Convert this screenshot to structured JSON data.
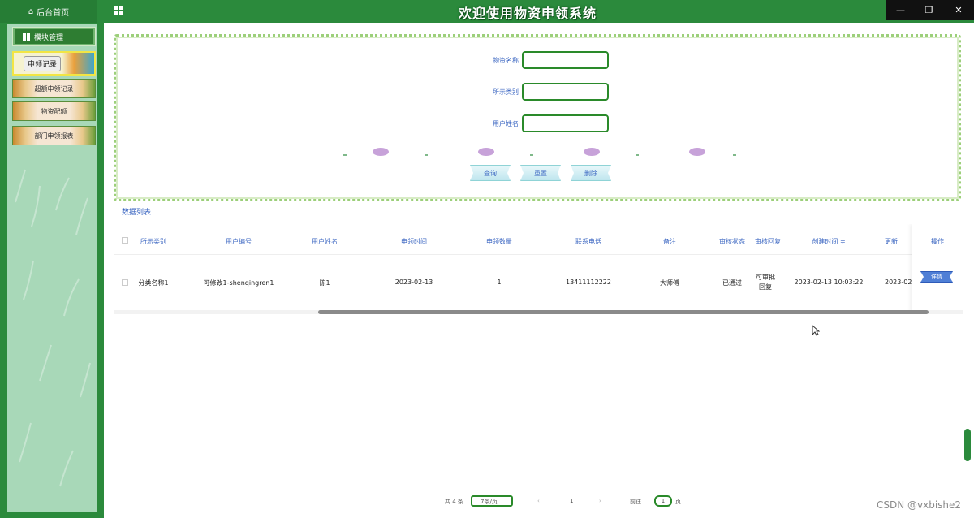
{
  "header": {
    "home_label": "后台首页",
    "title": "欢迎使用物资申领系统"
  },
  "window_controls": {
    "minimize": "—",
    "restore": "❐",
    "close": "✕"
  },
  "sidebar": {
    "section_label": "模块管理",
    "items": [
      {
        "label": "申领记录",
        "active": true
      },
      {
        "label": "超额申领记录"
      },
      {
        "label": "物资配额"
      },
      {
        "label": "部门申领报表"
      }
    ]
  },
  "search": {
    "fields": [
      {
        "label": "物资名称",
        "value": ""
      },
      {
        "label": "所示类别",
        "value": ""
      },
      {
        "label": "用户姓名",
        "value": ""
      }
    ],
    "buttons": {
      "query": "查询",
      "reset": "重置",
      "delete": "删除"
    }
  },
  "list_title": "数据列表",
  "table": {
    "columns": [
      "所示类别",
      "用户编号",
      "用户姓名",
      "申领时间",
      "申领数量",
      "联系电话",
      "备注",
      "审核状态",
      "审核回复",
      "创建时间 ≑",
      "更新",
      "操作"
    ],
    "rows": [
      {
        "category": "分类名称1",
        "user_no": "可修改1-shenqingren1",
        "user_name": "陈1",
        "apply_time": "2023-02-13",
        "quantity": "1",
        "phone": "13411112222",
        "remark": "大师傅",
        "status": "已通过",
        "reply": "可审批回复",
        "created": "2023-02-13 10:03:22",
        "updated": "2023-02-",
        "action": "详情"
      }
    ]
  },
  "pagination": {
    "total": "共 4 条",
    "page_size": "7条/页",
    "prev": "‹",
    "page": "1",
    "next": "›",
    "goto_prefix": "前往",
    "goto_value": "1",
    "goto_suffix": "页"
  },
  "watermark": "CSDN @vxbishe2",
  "colors": {
    "primary_green": "#2b8a3c",
    "sidebar_bg": "#a8d8b8",
    "link_blue": "#3c67c2"
  }
}
